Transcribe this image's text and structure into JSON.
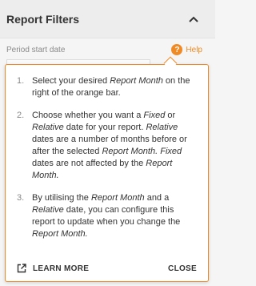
{
  "header": {
    "title": "Report Filters",
    "collapse_icon": "chevron-up-icon"
  },
  "field": {
    "label": "Period start date",
    "help_label": "Help",
    "help_icon": "question-icon"
  },
  "popover": {
    "accent": "#f08a24",
    "tips": [
      {
        "num": "1.",
        "parts": [
          "Select your desired ",
          {
            "em": "Report Month"
          },
          " on the right of the orange bar."
        ]
      },
      {
        "num": "2.",
        "parts": [
          "Choose whether you want a ",
          {
            "em": "Fixed"
          },
          " or ",
          {
            "em": "Relative"
          },
          " date for your report. ",
          {
            "em": "Relative"
          },
          " dates are a number of months before or after the selected ",
          {
            "em": "Report Month."
          },
          " ",
          {
            "em": "Fixed"
          },
          " dates are not affected by the ",
          {
            "em": "Report Month."
          }
        ]
      },
      {
        "num": "3.",
        "parts": [
          "By utilising the ",
          {
            "em": "Report Month"
          },
          " and a ",
          {
            "em": "Relative"
          },
          " date, you can configure this report to update when you change the ",
          {
            "em": "Report Month."
          }
        ]
      }
    ],
    "learn_more_label": "LEARN MORE",
    "learn_more_icon": "external-link-icon",
    "close_label": "CLOSE"
  }
}
